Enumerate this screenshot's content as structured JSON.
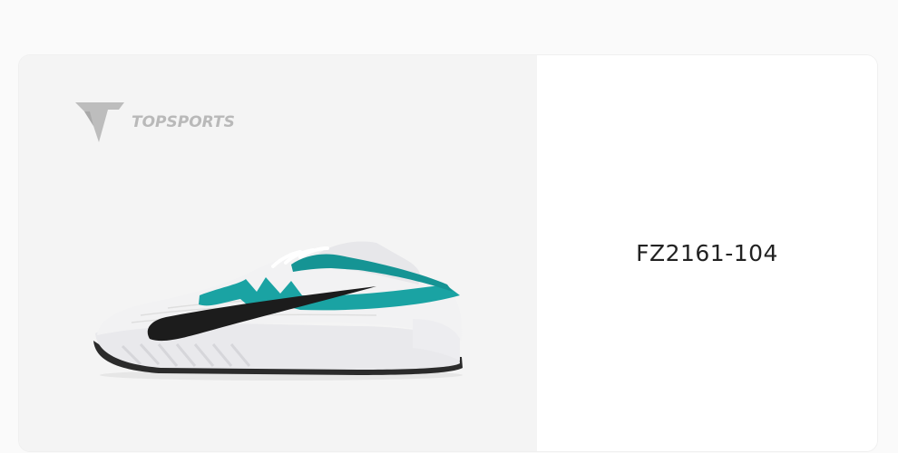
{
  "product": {
    "brand_name": "TOPSPORTS",
    "sku": "FZ2161-104",
    "image_icon": "sneaker-photo",
    "logo_icon": "topsports-logo-icon"
  },
  "colors": {
    "card_background": "#ffffff",
    "image_background": "#f4f4f4",
    "shoe_upper": "#f2f2f3",
    "shoe_accent": "#1aa3a3",
    "shoe_swoosh": "#1c1c1c",
    "logo_gray": "#b9b9b9"
  }
}
